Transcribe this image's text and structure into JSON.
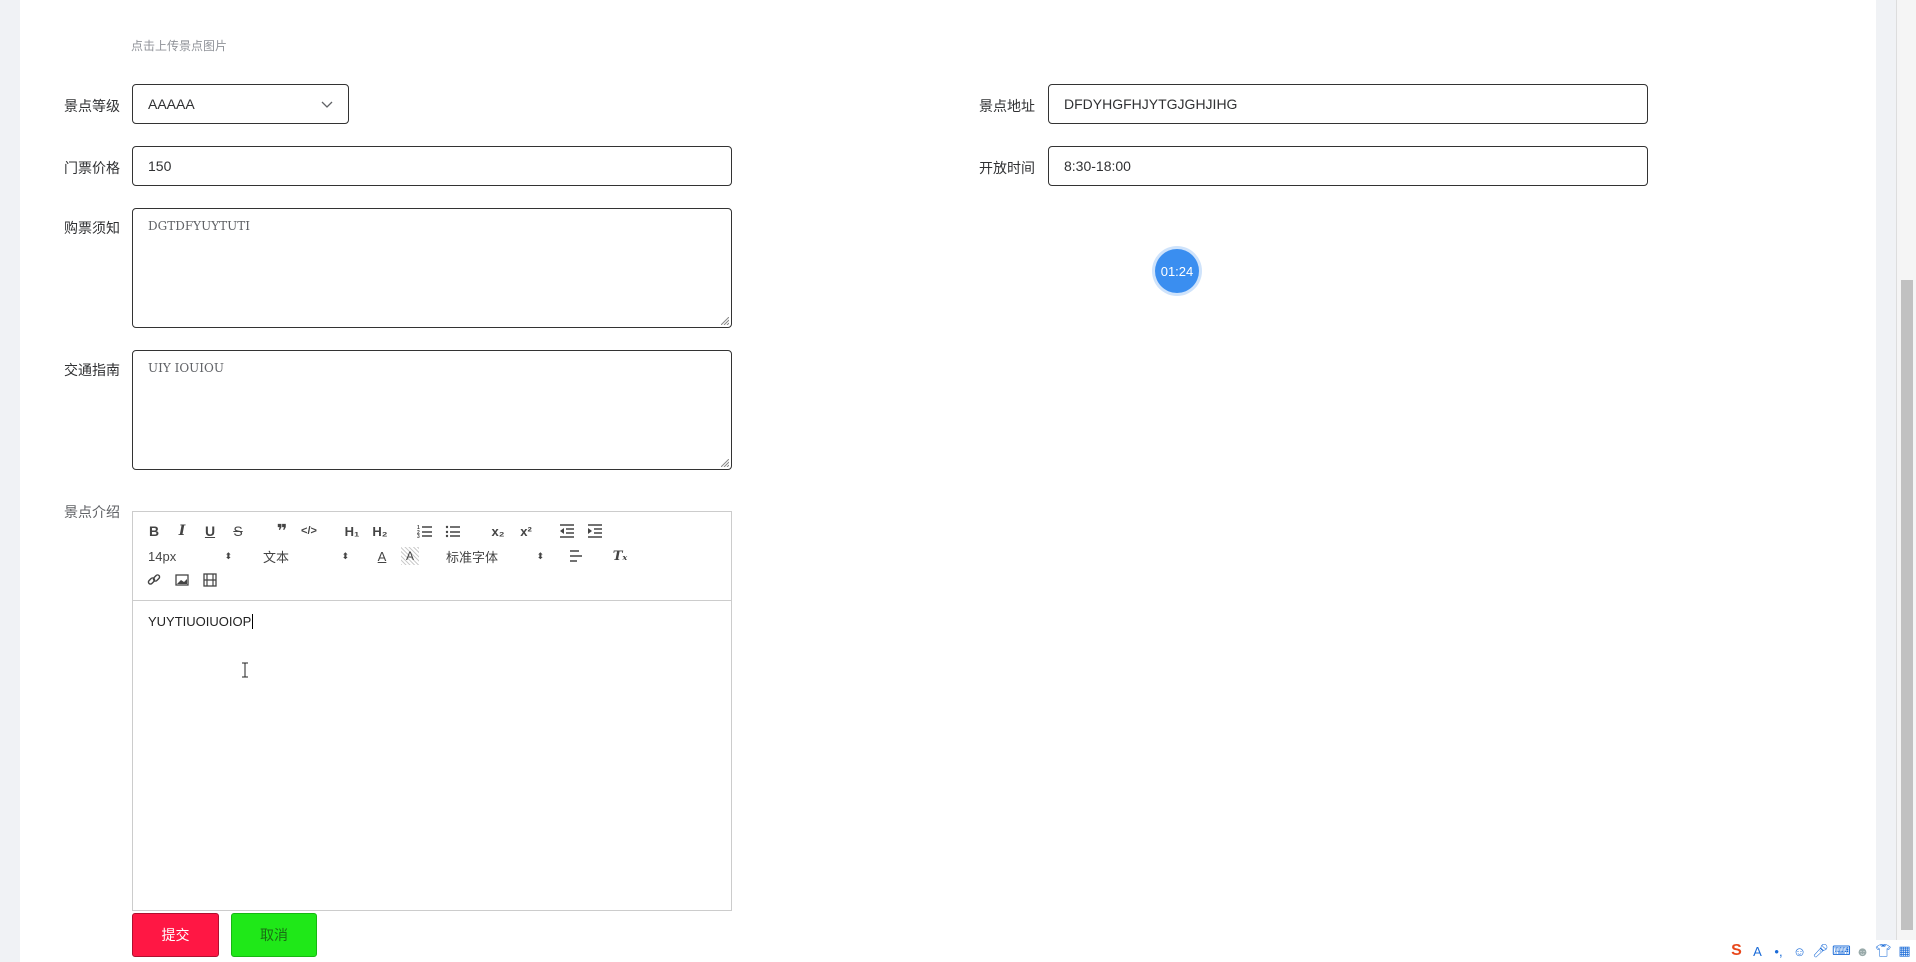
{
  "form": {
    "upload_hint": "点击上传景点图片",
    "level": {
      "label": "景点等级",
      "value": "AAAAA"
    },
    "address": {
      "label": "景点地址",
      "value": "DFDYHGFHJYTGJGHJIHG"
    },
    "price": {
      "label": "门票价格",
      "value": "150"
    },
    "open_time": {
      "label": "开放时间",
      "value": "8:30-18:00"
    },
    "notice": {
      "label": "购票须知",
      "value": "DGTDFYUYTUTI"
    },
    "traffic": {
      "label": "交通指南",
      "value": "UIY IOUIOU"
    },
    "intro": {
      "label": "景点介绍",
      "content": "YUYTIUOIUOIOP",
      "toolbar": {
        "size_value": "14px",
        "header_value": "文本",
        "font_value": "标准字体"
      }
    },
    "submit_label": "提交",
    "cancel_label": "取消"
  },
  "timer": {
    "value": "01:24"
  },
  "colors": {
    "submit": "#ff1744",
    "cancel": "#1fe818",
    "timer": "#3a8ef0"
  }
}
